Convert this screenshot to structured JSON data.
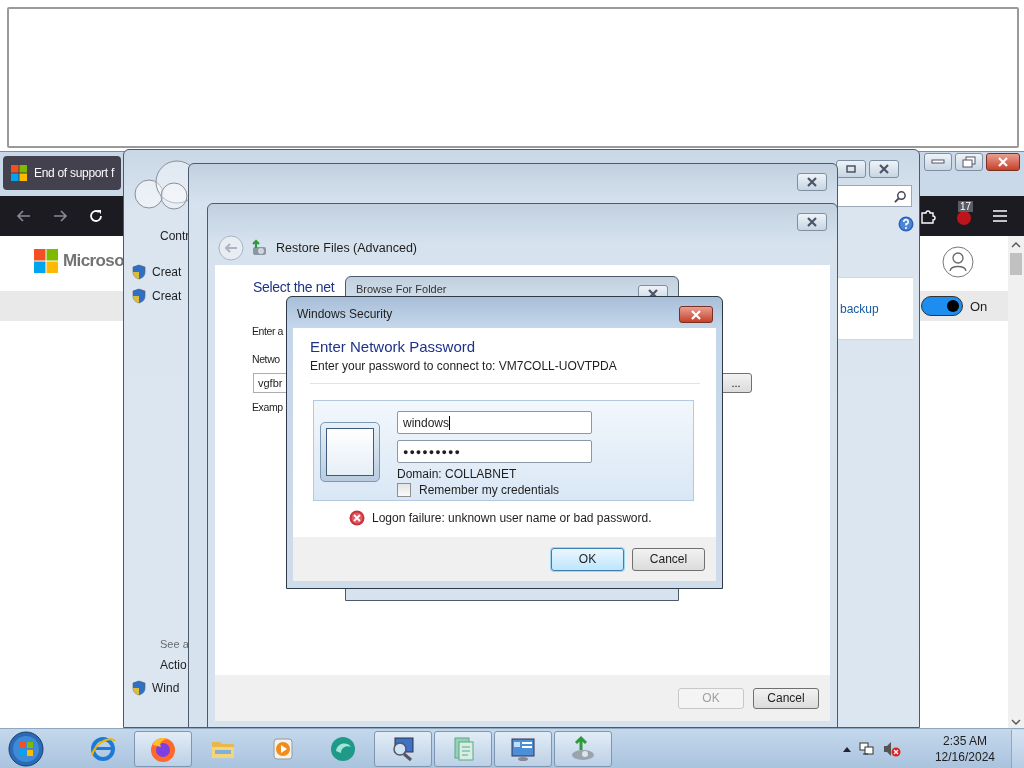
{
  "browser": {
    "tab_title": "End of support f",
    "logo_text": "Microso",
    "badge": "17",
    "toggle": {
      "on": true,
      "label": "On"
    }
  },
  "control_panel": {
    "nav_items": [
      {
        "text": "Contr",
        "kind": "plain"
      },
      {
        "text": "Creat",
        "kind": "shield"
      },
      {
        "text": "Creat",
        "kind": "shield"
      }
    ],
    "see_also": "See a",
    "footer_items": [
      {
        "text": "Actio",
        "kind": "plain"
      },
      {
        "text": "Wind",
        "kind": "shield"
      }
    ],
    "link": "backup"
  },
  "restore": {
    "title": "Restore Files (Advanced)",
    "heading": "Select the net",
    "lines": [
      "Enter a",
      "Netwo"
    ],
    "path_value": "vgfbr",
    "example": "Examp",
    "browse_label": "...",
    "buttons": [
      {
        "label": "OK",
        "disabled": true
      },
      {
        "label": "Cancel",
        "disabled": false
      }
    ]
  },
  "browse_dialog": {
    "title": "Browse For Folder"
  },
  "security": {
    "title": "Windows Security",
    "heading": "Enter Network Password",
    "subtitle": "Enter your password to connect to: VM7COLL-UOVTPDA",
    "username": "windows",
    "password": "●●●●●●●●●",
    "domain": "Domain: COLLABNET",
    "remember": {
      "label": "Remember my credentials",
      "checked": false
    },
    "error": "Logon failure: unknown user name or bad password.",
    "buttons": [
      {
        "label": "OK",
        "default": true
      },
      {
        "label": "Cancel",
        "default": false
      }
    ]
  },
  "taskbar": {
    "apps": [
      {
        "kind": "ie",
        "running": false
      },
      {
        "kind": "firefox",
        "running": true
      },
      {
        "kind": "explorer",
        "running": false
      },
      {
        "kind": "media",
        "running": false
      },
      {
        "kind": "teal",
        "running": false
      },
      {
        "kind": "search",
        "running": true
      },
      {
        "kind": "document",
        "running": true
      },
      {
        "kind": "panel",
        "running": true
      },
      {
        "kind": "backup",
        "running": true
      }
    ],
    "time": "2:35 AM",
    "date": "12/16/2024"
  }
}
